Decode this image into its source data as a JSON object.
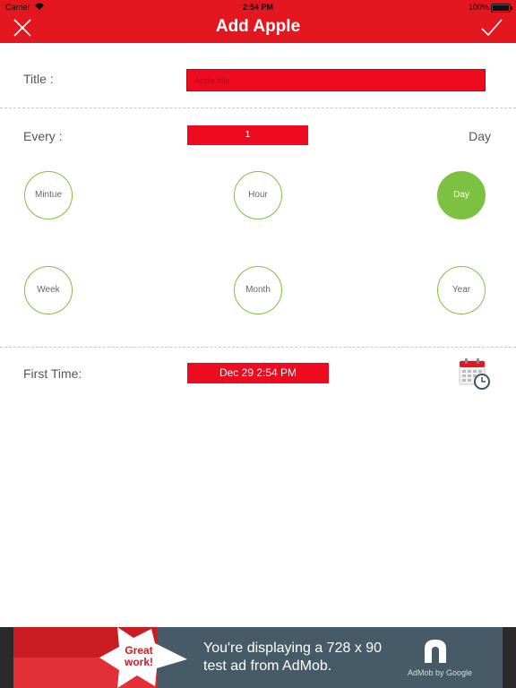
{
  "status_bar": {
    "carrier": "Carrier",
    "time": "2:54 PM",
    "battery": "100%"
  },
  "nav": {
    "title": "Add Apple",
    "close_icon": "close-icon",
    "done_icon": "checkmark-icon"
  },
  "form": {
    "title_label": "Title :",
    "title_placeholder": "Apple title",
    "title_value": "",
    "every_label": "Every :",
    "every_value": "1",
    "unit_value": "Day",
    "units": [
      "Mintue",
      "Hour",
      "Day",
      "Week",
      "Month",
      "Year"
    ],
    "selected_unit": "Day",
    "first_time_label": "First Time:",
    "first_time_value": "Dec 29 2:54 PM",
    "calendar_icon": "calendar-clock-icon"
  },
  "ad": {
    "badge": "Great work!",
    "text_line1": "You're displaying a 728 x 90",
    "text_line2": "test ad from AdMob.",
    "brand": "AdMob by Google"
  },
  "colors": {
    "accent": "#e4161f",
    "field": "#ee0b1f",
    "selected": "#7dc142"
  }
}
